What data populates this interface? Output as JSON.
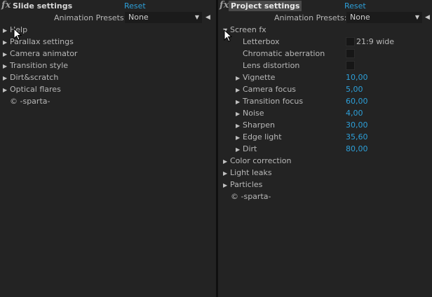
{
  "left": {
    "fx": "fx",
    "title": "Slide settings",
    "reset": "Reset",
    "presets_label": "Animation Presets:",
    "presets_value": "None",
    "items": [
      {
        "label": "Help"
      },
      {
        "label": "Parallax settings"
      },
      {
        "label": "Camera animator"
      },
      {
        "label": "Transition style"
      },
      {
        "label": "Dirt&scratch"
      },
      {
        "label": "Optical flares"
      }
    ],
    "credit": "© -sparta-"
  },
  "right": {
    "fx": "fx",
    "title": "Project settings",
    "reset": "Reset",
    "presets_label": "Animation Presets:",
    "presets_value": "None",
    "screen_fx": {
      "label": "Screen fx",
      "letterbox": {
        "label": "Letterbox",
        "value": "21:9 wide"
      },
      "chromatic": {
        "label": "Chromatic aberration"
      },
      "lens": {
        "label": "Lens distortion"
      },
      "params": [
        {
          "label": "Vignette",
          "value": "10,00"
        },
        {
          "label": "Camera focus",
          "value": "5,00"
        },
        {
          "label": "Transition focus",
          "value": "60,00"
        },
        {
          "label": "Noise",
          "value": "4,00"
        },
        {
          "label": "Sharpen",
          "value": "30,00"
        },
        {
          "label": "Edge light",
          "value": "35,60"
        },
        {
          "label": "Dirt",
          "value": "80,00"
        }
      ]
    },
    "groups": [
      {
        "label": "Color correction"
      },
      {
        "label": "Light leaks"
      },
      {
        "label": "Particles"
      }
    ],
    "credit": "© -sparta-"
  },
  "icons": {
    "collapsed": "triangle-right-icon",
    "expanded": "triangle-down-icon",
    "dropdown": "chevron-down-icon",
    "panel_menu": "triangle-left-icon",
    "pointer": "mouse-cursor-icon"
  },
  "colors": {
    "background": "#232323",
    "value_blue": "#2d9fd8",
    "text": "#b8b8b8",
    "active_tab": "#4a4a4a"
  }
}
